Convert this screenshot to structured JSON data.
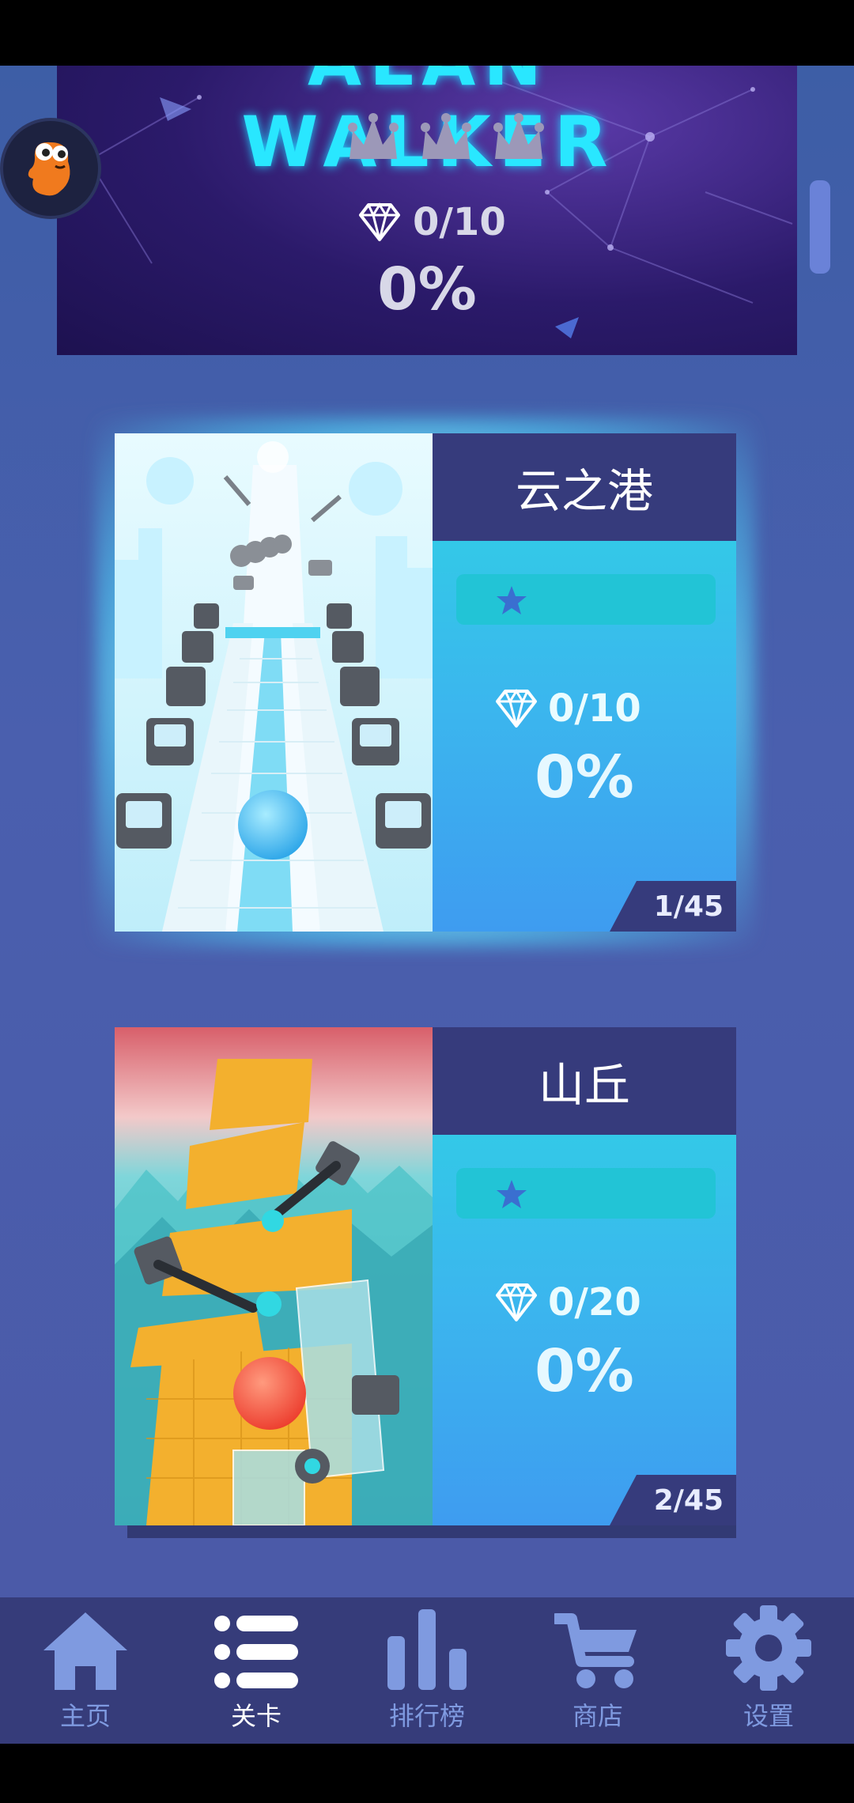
{
  "top_card": {
    "title_fragment": "ALAN WALKER",
    "gems": "0/10",
    "percent": "0%"
  },
  "levels": [
    {
      "name": "云之港",
      "gems": "0/10",
      "percent": "0%",
      "counter": "1/45"
    },
    {
      "name": "山丘",
      "gems": "0/20",
      "percent": "0%",
      "counter": "2/45"
    }
  ],
  "nav": [
    {
      "label": "主页",
      "icon": "home-icon"
    },
    {
      "label": "关卡",
      "icon": "list-icon"
    },
    {
      "label": "排行榜",
      "icon": "leaderboard-icon"
    },
    {
      "label": "商店",
      "icon": "cart-icon"
    },
    {
      "label": "设置",
      "icon": "gear-icon"
    }
  ],
  "colors": {
    "background": "#4a5fae",
    "nav_bg": "#363c7a",
    "card_header": "#363b7c",
    "card_info_top": "#2ed4e3",
    "card_info_bottom": "#3e9cf0",
    "nav_inactive": "#7f9ae0",
    "nav_active": "#ffffff"
  }
}
